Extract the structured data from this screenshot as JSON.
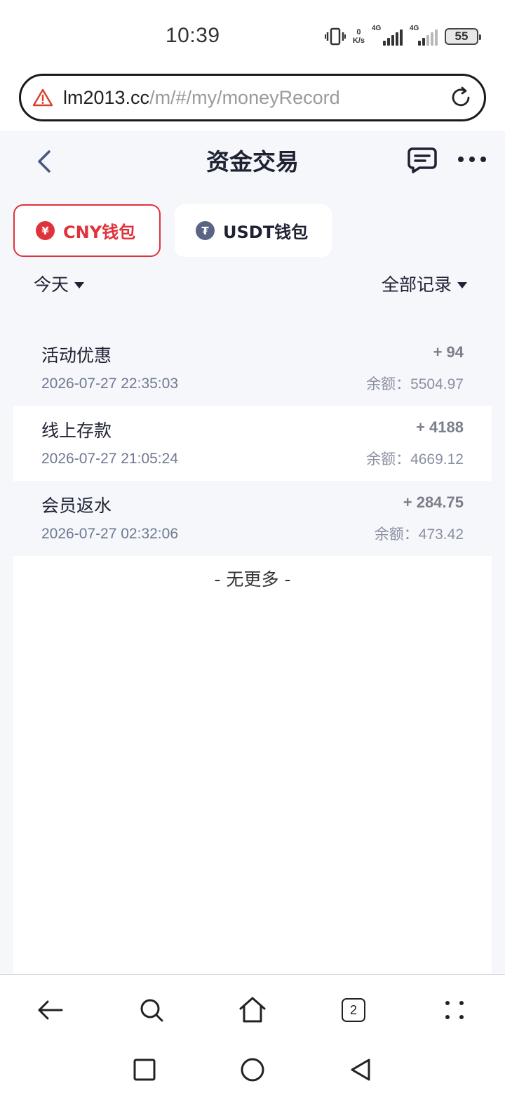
{
  "status_bar": {
    "time": "10:39",
    "net_speed_value": "0",
    "net_speed_unit": "K/s",
    "signal1_label": "4G",
    "signal2_label": "4G",
    "battery": "55"
  },
  "address_bar": {
    "url_host": "lm2013.cc",
    "url_path": "/m/#/my/moneyRecord"
  },
  "header": {
    "title": "资金交易"
  },
  "wallet_tabs": [
    {
      "label": "CNY钱包",
      "coin_symbol": "¥",
      "active": true
    },
    {
      "label": "USDT钱包",
      "coin_symbol": "₮",
      "active": false
    }
  ],
  "filters": {
    "date": "今天",
    "type": "全部记录"
  },
  "records": [
    {
      "title": "活动优惠",
      "time": "2026-07-27 22:35:03",
      "amount": "+ 94",
      "balance": "余额：5504.97"
    },
    {
      "title": "线上存款",
      "time": "2026-07-27 21:05:24",
      "amount": "+ 4188",
      "balance": "余额：4669.12"
    },
    {
      "title": "会员返水",
      "time": "2026-07-27 02:32:06",
      "amount": "+ 284.75",
      "balance": "余额：473.42"
    }
  ],
  "list_end": "- 无更多 -",
  "browser_toolbar": {
    "tab_count": "2"
  },
  "colors": {
    "accent_red": "#e0323c",
    "text_dark": "#1e2233",
    "page_bg": "#f5f7fb"
  }
}
